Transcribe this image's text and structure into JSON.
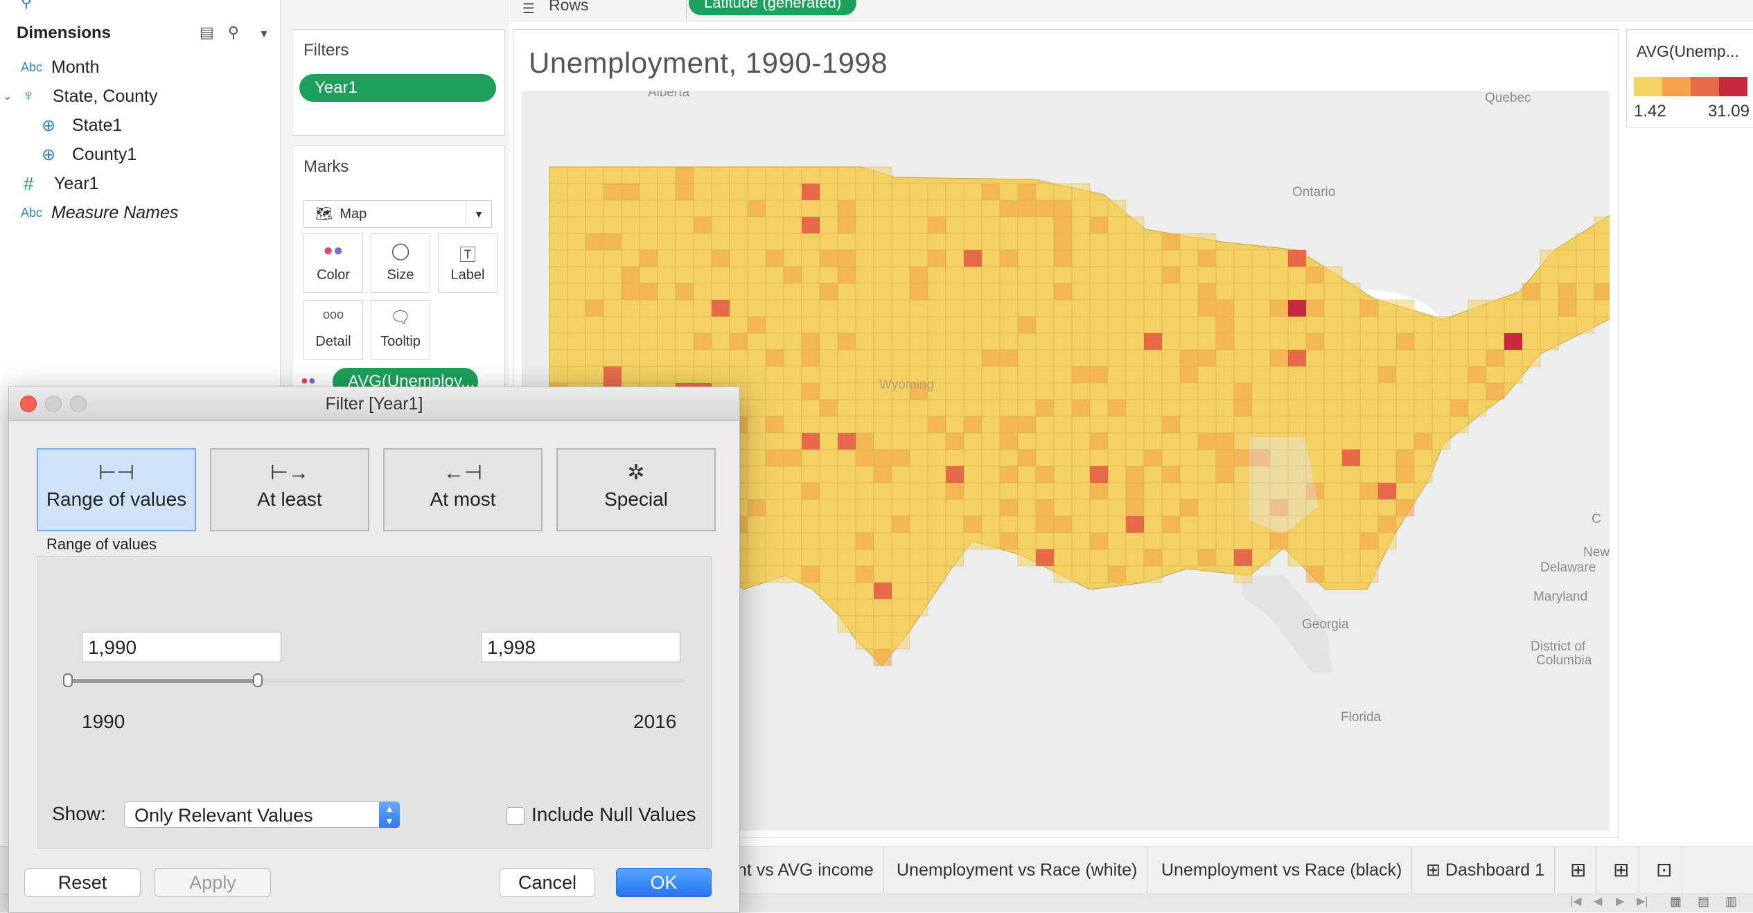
{
  "shelves": {
    "rows_label": "Rows",
    "rows_pill": "Latitude (generated)"
  },
  "data_pane": {
    "title": "Dimensions",
    "fields": [
      {
        "type": "Abc",
        "label": "Month"
      },
      {
        "type": "hierarchy",
        "label": "State, County"
      },
      {
        "type": "geo",
        "label": "State1"
      },
      {
        "type": "geo",
        "label": "County1"
      },
      {
        "type": "#",
        "label": "Year1"
      },
      {
        "type": "Abc",
        "label": "Measure Names"
      }
    ]
  },
  "filters_card": {
    "title": "Filters",
    "pill": "Year1"
  },
  "marks_card": {
    "title": "Marks",
    "mark_type": "Map",
    "buttons": [
      "Color",
      "Size",
      "Label",
      "Detail",
      "Tooltip"
    ],
    "color_pill": "AVG(Unemploy..."
  },
  "viz": {
    "title": "Unemployment, 1990-1998",
    "map_labels": [
      "Alberta",
      "Quebec",
      "Ontario",
      "Wyoming",
      "Georgia",
      "Florida",
      "Delaware",
      "Maryland",
      "District of",
      "Columbia",
      "New",
      "C"
    ]
  },
  "legend": {
    "title": "AVG(Unemp...",
    "min": "1.42",
    "max": "31.09",
    "colors": [
      "#f6d365",
      "#f5a24a",
      "#e66a4a",
      "#c9293f"
    ]
  },
  "tabs": [
    "nt vs AVG income",
    "Unemployment vs Race (white)",
    "Unemployment vs Race (black)",
    "Dashboard 1"
  ],
  "dialog": {
    "title": "Filter [Year1]",
    "modes": [
      "Range of values",
      "At least",
      "At most",
      "Special"
    ],
    "selected_mode": "Range of values",
    "section_label": "Range of values",
    "min_value": "1,990",
    "max_value": "1,998",
    "range_min_label": "1990",
    "range_max_label": "2016",
    "show_label": "Show:",
    "show_value": "Only Relevant Values",
    "include_null_label": "Include Null Values",
    "include_null_checked": false,
    "buttons": {
      "reset": "Reset",
      "apply": "Apply",
      "cancel": "Cancel",
      "ok": "OK"
    },
    "slider": {
      "domain_min": 1990,
      "domain_max": 2016,
      "low": 1990,
      "high": 1998
    }
  }
}
